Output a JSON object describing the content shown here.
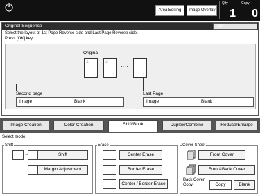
{
  "header": {
    "power_icon": "⏻",
    "area_editing": "Area Editing",
    "image_overlay": "Image Overlay",
    "qty_label": "Q'ty",
    "qty_value": "1",
    "copy_label": "Copy",
    "copy_value": "0"
  },
  "dialog": {
    "title": "Original Sequence",
    "ok": "OK",
    "instruction_1": "Select the layout of 1st Page Reverse side and Last Page Reverse side.",
    "instruction_2": "Press [OK] key.",
    "original_label": "Original",
    "page1_num": "1",
    "page2_num": "3",
    "ellipsis": "····",
    "second_page": {
      "label": "Second page",
      "options": [
        "Image",
        "Blank"
      ],
      "selected": "Image"
    },
    "last_page": {
      "label": "Last Page",
      "options": [
        "Image",
        "Blank"
      ],
      "selected": "Image"
    }
  },
  "tabs": [
    "Image Creation",
    "Color Creation",
    "Shift/Book",
    "Duplex/Combine",
    "Reduce/Enlarge"
  ],
  "active_tab": "Shift/Book",
  "select_mode": "Select mode.",
  "shift": {
    "label": "Shift",
    "arrow": "→",
    "shift_btn": "Shift",
    "margin_btn": "Margin Adjustment"
  },
  "erase": {
    "label": "Erase",
    "center": "Center Erase",
    "border": "Border Erase",
    "center_border": "Center / Border Erase"
  },
  "cover": {
    "label": "Cover Sheet",
    "front": "Front Cover",
    "front_back": "Front&Back Cover",
    "back_cover_label": "Back Cover\nCopy",
    "copy": "Copy",
    "blank": "Blank"
  }
}
